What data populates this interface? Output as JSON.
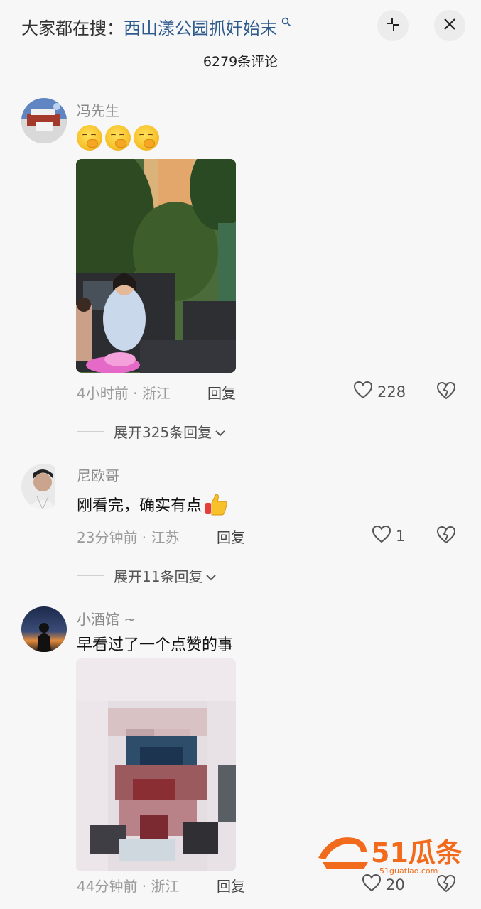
{
  "header": {
    "search_prefix": "大家都在搜：",
    "search_query": "西山漾公园抓奸始末",
    "comment_count": "6279条评论"
  },
  "comments": [
    {
      "username": "冯先生",
      "time": "4小时前",
      "separator": " · ",
      "location": "浙江",
      "reply_label": "回复",
      "likes": "228",
      "expand_label": "展开325条回复"
    },
    {
      "username": "尼欧哥",
      "text": "刚看完，确实有点",
      "time": "23分钟前",
      "separator": " · ",
      "location": "江苏",
      "reply_label": "回复",
      "likes": "1",
      "expand_label": "展开11条回复"
    },
    {
      "username": "小酒馆 ~",
      "text": "早看过了一个点赞的事",
      "time": "44分钟前",
      "separator": " · ",
      "location": "浙江",
      "reply_label": "回复",
      "likes": "20"
    }
  ],
  "watermark": {
    "brand": "51瓜条",
    "url": "51guatiao.com"
  },
  "colors": {
    "background": "#f7f7f7",
    "search_query": "#2d5a8c",
    "watermark": "#f26a1b"
  }
}
